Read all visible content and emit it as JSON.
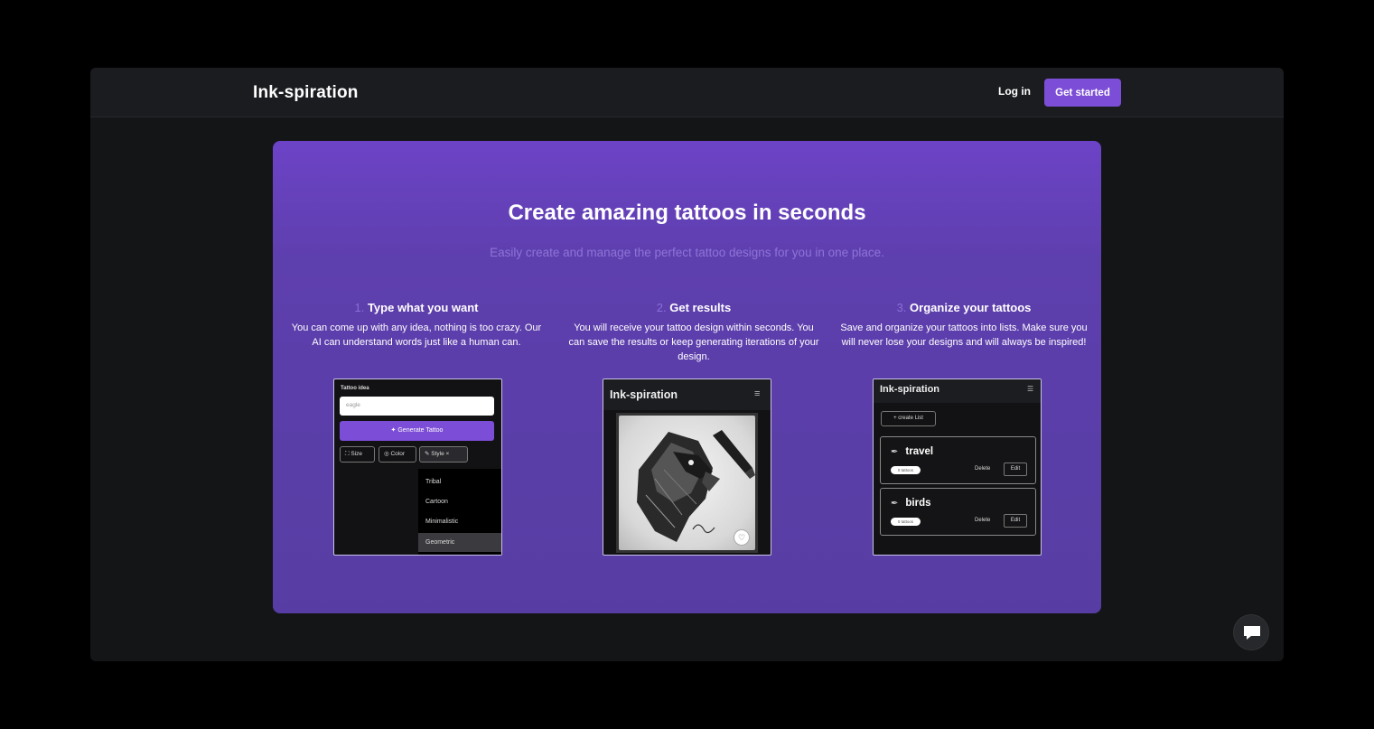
{
  "header": {
    "brand": "Ink-spiration",
    "login_label": "Log in",
    "get_started_label": "Get started"
  },
  "hero": {
    "title": "Create amazing tattoos in seconds",
    "subtitle": "Easily create and manage the perfect tattoo designs for you in one place."
  },
  "steps": [
    {
      "number": "1.",
      "title": "Type what you want",
      "description": "You can come up with any idea, nothing is too crazy. Our AI can understand words just like a human can."
    },
    {
      "number": "2.",
      "title": "Get results",
      "description": "You will receive your tattoo design within seconds. You can save the results or keep generating iterations of your design."
    },
    {
      "number": "3.",
      "title": "Organize your tattoos",
      "description": "Save and organize your tattoos into lists. Make sure you will never lose your designs and will always be inspired!"
    }
  ],
  "mock_generate": {
    "label": "Tattoo idea",
    "input_value": "eagle",
    "generate_label": "Generate Tattoo",
    "chips": [
      "Size",
      "Color",
      "Style"
    ],
    "style_options": [
      "Tribal",
      "Cartoon",
      "Minimalistic",
      "Geometric"
    ],
    "selected_option": "Geometric"
  },
  "mock_results": {
    "brand": "Ink-spiration"
  },
  "mock_lists": {
    "brand": "Ink-spiration",
    "create_label": "+ create List",
    "lists": [
      {
        "name": "travel",
        "badge": "0 tattoos",
        "delete_label": "Delete",
        "edit_label": "Edit"
      },
      {
        "name": "birds",
        "badge": "0 tattoos",
        "delete_label": "Delete",
        "edit_label": "Edit"
      }
    ]
  },
  "colors": {
    "accent": "#7c4dd6",
    "hero_top": "#6c43c6",
    "hero_bottom": "#573da3",
    "page_bg": "#141517"
  },
  "icons": {
    "chat": "chat-bubble-icon",
    "menu": "hamburger-menu-icon",
    "heart": "heart-icon",
    "pen": "pen-icon"
  }
}
